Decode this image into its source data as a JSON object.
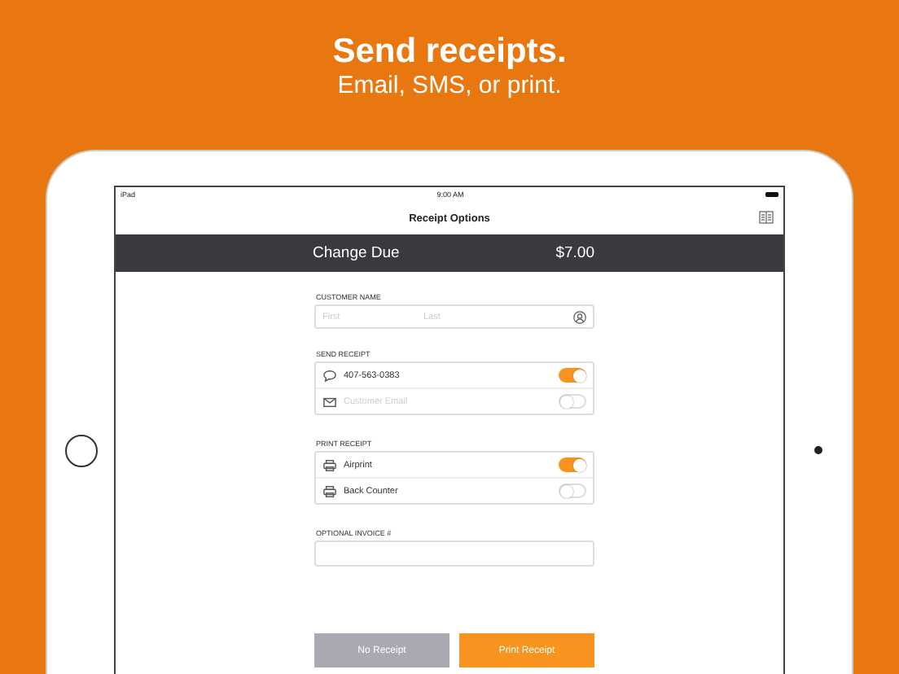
{
  "banner": {
    "title": "Send receipts.",
    "subtitle": "Email, SMS, or print."
  },
  "status_bar": {
    "device": "iPad",
    "time": "9:00 AM"
  },
  "nav": {
    "title": "Receipt Options"
  },
  "summary": {
    "label": "Change Due",
    "amount": "$7.00"
  },
  "customer_name": {
    "label": "CUSTOMER NAME",
    "first_placeholder": "First",
    "last_placeholder": "Last"
  },
  "sections": [
    {
      "label": "SEND RECEIPT",
      "rows": [
        {
          "kind": "message",
          "value": "407-563-0383",
          "on": true
        },
        {
          "kind": "email",
          "placeholder": "Customer Email",
          "on": false
        }
      ]
    },
    {
      "label": "PRINT RECEIPT",
      "rows": [
        {
          "kind": "printer",
          "value": "Airprint",
          "on": true
        },
        {
          "kind": "printer",
          "value": "Back Counter",
          "on": false
        }
      ]
    }
  ],
  "invoice": {
    "label": "OPTIONAL INVOICE #"
  },
  "buttons": [
    {
      "label": "No Receipt",
      "kind": "secondary"
    },
    {
      "label": "Print Receipt",
      "kind": "primary"
    }
  ]
}
